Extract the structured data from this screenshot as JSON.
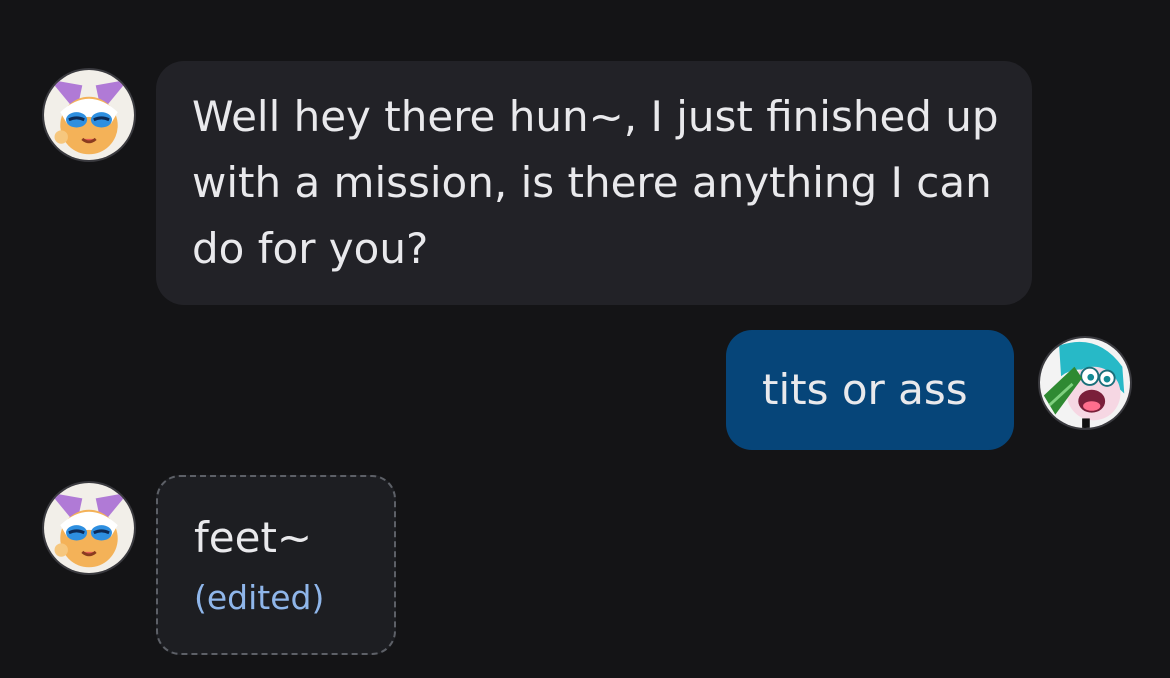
{
  "messages": [
    {
      "sender": "bot",
      "text": "Well hey there hun~, I just finished up with a mission, is there anything I can do for you?"
    },
    {
      "sender": "user",
      "text": "tits or ass"
    },
    {
      "sender": "bot",
      "text": "feet~",
      "edited_label": "(edited)"
    }
  ],
  "colors": {
    "background": "#141416",
    "bot_bubble": "#222227",
    "user_bubble": "#064579",
    "edited_text": "#8fb6ea"
  },
  "icons": {
    "bot_avatar": "bat-character-avatar",
    "user_avatar": "green-haired-character-avatar"
  }
}
